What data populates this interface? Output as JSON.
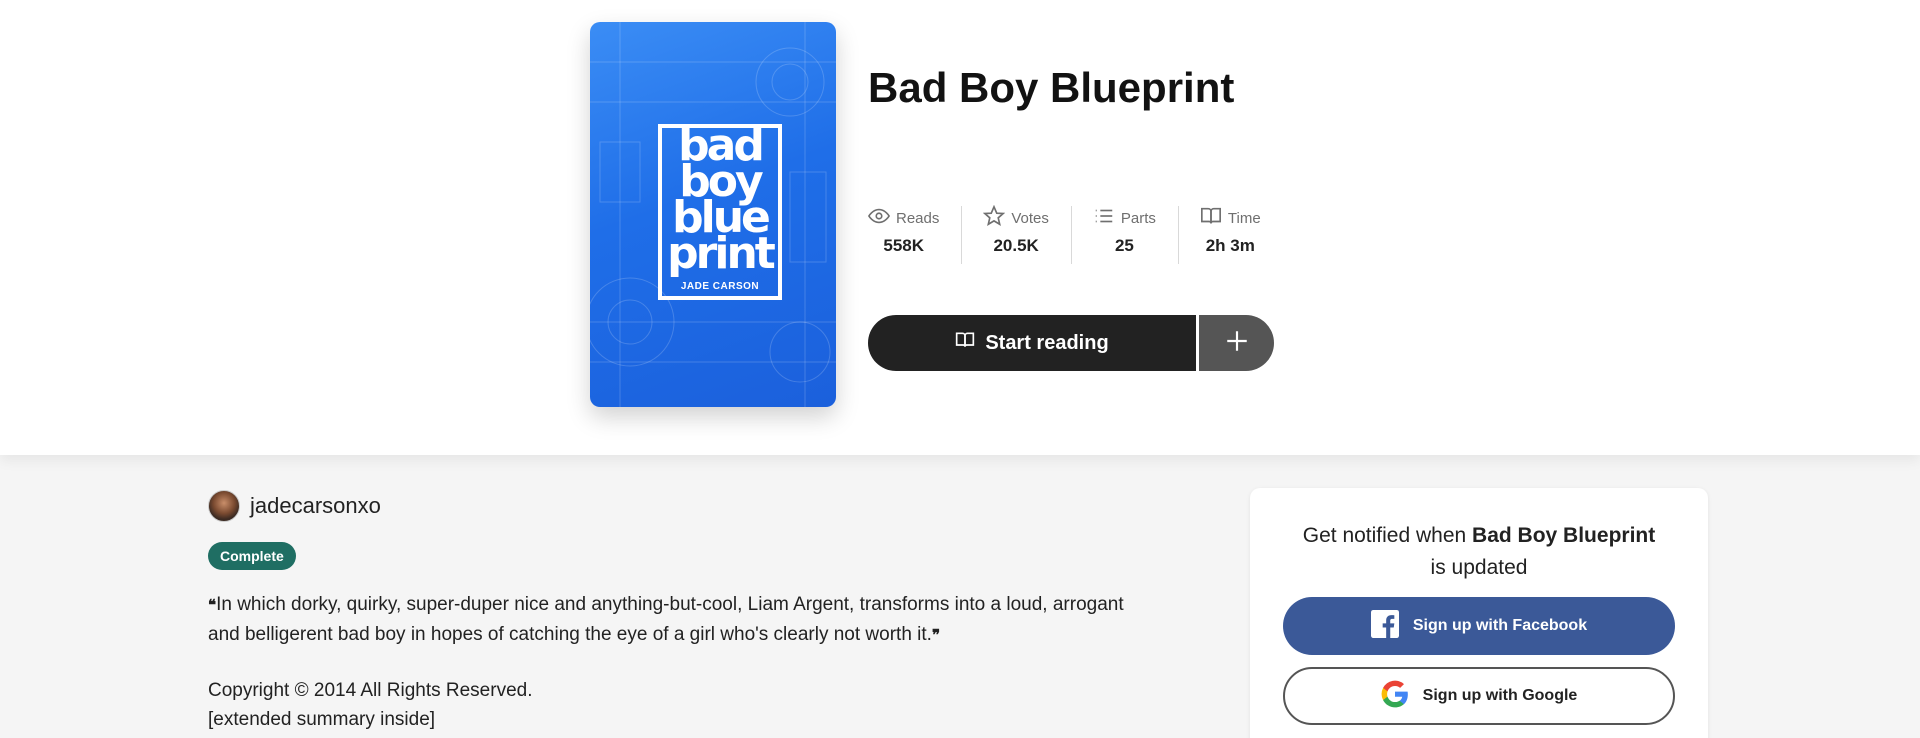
{
  "story": {
    "title": "Bad Boy Blueprint",
    "cover": {
      "title_lines": [
        "bad",
        "boy",
        "blue",
        "print"
      ],
      "author": "JADE CARSON",
      "background_color": "#1f6ee8"
    }
  },
  "stats": [
    {
      "icon": "eye-icon",
      "label": "Reads",
      "value": "558K"
    },
    {
      "icon": "star-icon",
      "label": "Votes",
      "value": "20.5K"
    },
    {
      "icon": "list-icon",
      "label": "Parts",
      "value": "25"
    },
    {
      "icon": "book-icon",
      "label": "Time",
      "value": "2h 3m"
    }
  ],
  "actions": {
    "start_reading": "Start reading",
    "add_icon": "plus-icon"
  },
  "author": {
    "username": "jadecarsonxo"
  },
  "status_badge": "Complete",
  "description": {
    "summary": "In which dorky, quirky, super-duper nice and anything-but-cool, Liam Argent, transforms into a loud, arrogant and belligerent bad boy in hopes of catching the eye of a girl who's clearly not worth it.",
    "open_quote": "❝",
    "close_quote": "❞",
    "copyright": "Copyright © 2014 All Rights Reserved.",
    "extended": "[extended summary inside]"
  },
  "notify_card": {
    "prefix": "Get notified when",
    "story_title": "Bad Boy Blueprint",
    "suffix": "is updated",
    "facebook_button": "Sign up with Facebook",
    "google_button": "Sign up with Google"
  },
  "colors": {
    "primary_button": "#222222",
    "secondary_button": "#555555",
    "badge": "#1f6e63",
    "facebook": "#3b5998"
  }
}
